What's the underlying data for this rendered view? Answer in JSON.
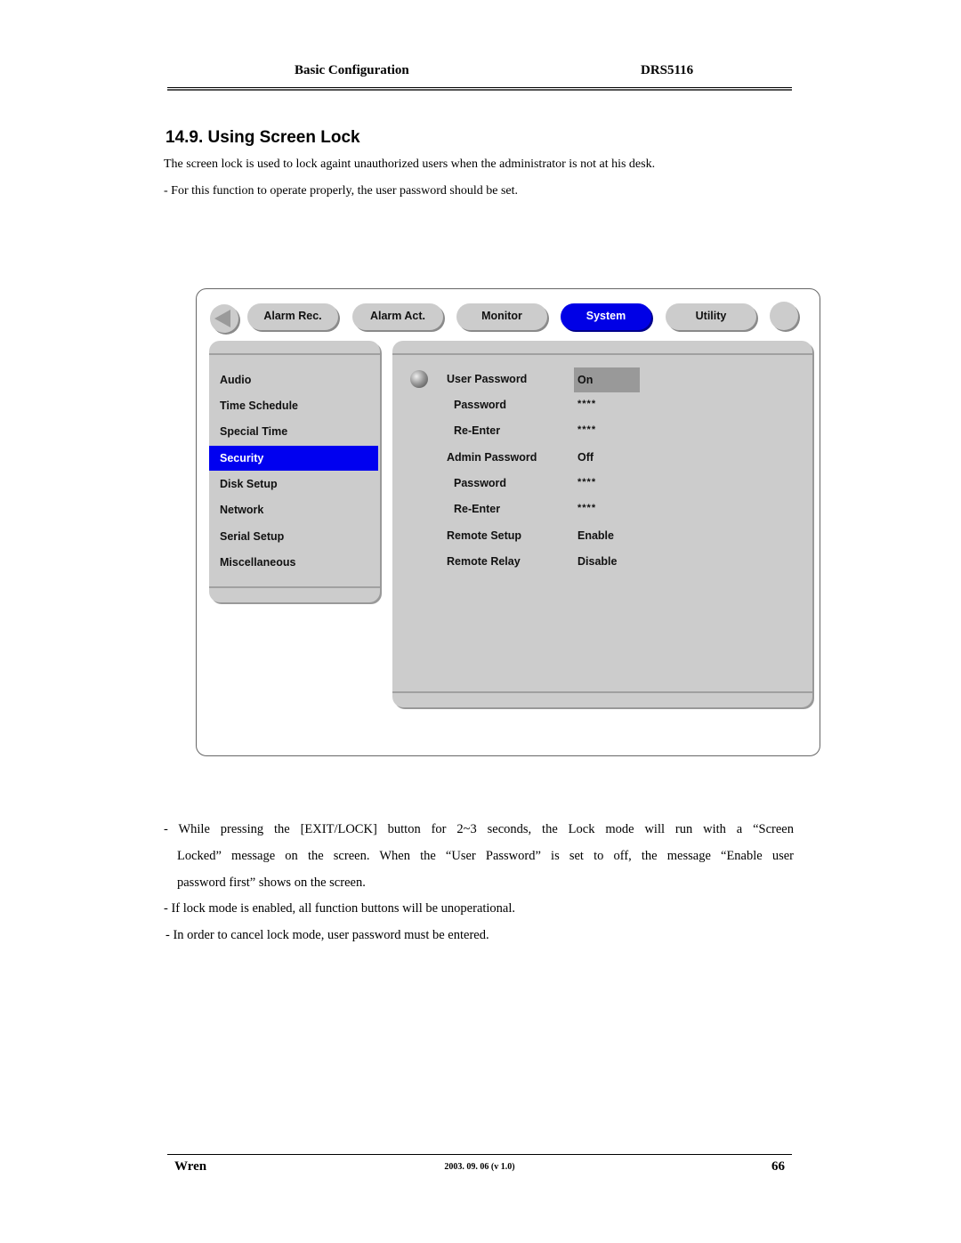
{
  "header": {
    "section": "Basic Configuration",
    "model": "DRS5116"
  },
  "title": "14.9. Using Screen Lock",
  "intro": [
    "The screen lock is used to lock againt unauthorized users when the administrator is not at his desk.",
    "- For this function to operate properly, the user password should be set."
  ],
  "dvr_ui": {
    "back_icon": "left-triangle-icon",
    "tabs": [
      {
        "label": "Alarm Rec.",
        "active": false
      },
      {
        "label": "Alarm Act.",
        "active": false
      },
      {
        "label": "Monitor",
        "active": false
      },
      {
        "label": "System",
        "active": true
      },
      {
        "label": "Utility",
        "active": false
      }
    ],
    "menu": [
      {
        "label": "Audio",
        "active": false
      },
      {
        "label": "Time Schedule",
        "active": false
      },
      {
        "label": "Special Time",
        "active": false
      },
      {
        "label": "Security",
        "active": true
      },
      {
        "label": "Disk Setup",
        "active": false
      },
      {
        "label": "Network",
        "active": false
      },
      {
        "label": "Serial Setup",
        "active": false
      },
      {
        "label": "Miscellaneous",
        "active": false
      }
    ],
    "settings": [
      {
        "label": "User Password",
        "value": "On",
        "selected": true,
        "indent": false
      },
      {
        "label": "Password",
        "value": "****",
        "selected": false,
        "indent": true
      },
      {
        "label": "Re-Enter",
        "value": "****",
        "selected": false,
        "indent": true
      },
      {
        "label": "Admin Password",
        "value": "Off",
        "selected": false,
        "indent": false
      },
      {
        "label": "Password",
        "value": "****",
        "selected": false,
        "indent": true
      },
      {
        "label": "Re-Enter",
        "value": "****",
        "selected": false,
        "indent": true
      },
      {
        "label": "Remote Setup",
        "value": "Enable",
        "selected": false,
        "indent": false
      },
      {
        "label": "Remote Relay",
        "value": "Disable",
        "selected": false,
        "indent": false
      }
    ],
    "colors": {
      "active_blue": "#0000f0",
      "panel_gray": "#cccccc",
      "selected_value_gray": "#999999"
    }
  },
  "notes": {
    "bullet1_line1": "- While pressing the [EXIT/LOCK] button for 2~3 seconds, the Lock mode will run with a “Screen",
    "bullet1_line2": "Locked” message on the screen.   When the “User Password” is set to off, the message “Enable user",
    "bullet1_line3": "password first” shows on the screen.",
    "bullet2": "- If lock mode is enabled, all function buttons will be unoperational.",
    "bullet3": "- In order to cancel lock mode, user password must be entered."
  },
  "footer": {
    "author": "Wren",
    "date_version": "2003. 09. 06 (v 1.0)",
    "page": "66"
  }
}
